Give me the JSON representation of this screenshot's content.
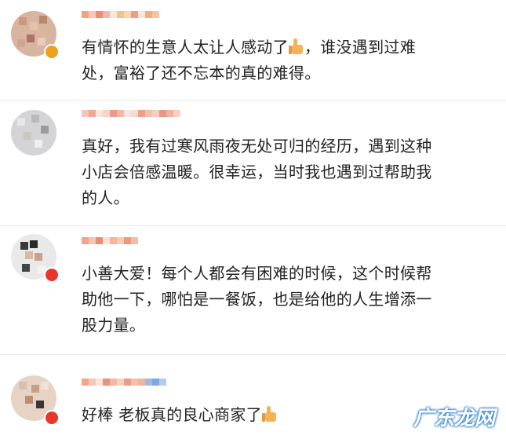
{
  "comments": [
    {
      "text_lines": [
        "有情怀的生意人太让人感动了",
        "，谁没遇到过难",
        "处，富裕了还不忘本的真的难得。"
      ],
      "user_colors": [
        "#f2a27c",
        "#f6c9b3",
        "#ea8f77",
        "#f4b9a0",
        "#f3c18a",
        "#f7d6b0",
        "#e8a07f",
        "#f0b07a",
        "#f7c3a1",
        "#e68e6f",
        "#f1b18b"
      ]
    },
    {
      "text_lines": [
        "真好，我有过寒风雨夜无处可归的经历，遇到这种",
        "小店会倍感温暖。很幸运，当时我也遇到过帮助我",
        "的人。"
      ],
      "user_colors": [
        "#f4c6b7",
        "#f0a79a",
        "#f7d4c8",
        "#ea9b8e",
        "#f3b7a6",
        "#f8dcd2",
        "#ee9f90",
        "#f2c0b2",
        "#f6cdbf",
        "#e9958a",
        "#f3b1a3",
        "#f7d1c5"
      ]
    },
    {
      "text_lines": [
        "小善大爱！每个人都会有困难的时候，这个时候帮",
        "助他一下，哪怕是一餐饭，也是给他的人生增添一",
        "股力量。"
      ],
      "user_colors": [
        "#f1a58c",
        "#f6c4b0",
        "#e88e72",
        "#f3b59c",
        "#f7cdb8",
        "#ed9a80",
        "#f4bda6"
      ]
    },
    {
      "text_lines": [
        "好棒 老板真的良心商家了"
      ],
      "user_colors": [
        "#f2a78c",
        "#f6c7b3",
        "#ea9377",
        "#f3b9a2",
        "#f7d2bf",
        "#ee9d84",
        "#f4bfa9",
        "#f1b49a",
        "#9bbbe6",
        "#7fa7e0",
        "#b3cdf0"
      ]
    }
  ],
  "watermark": "广东龙网"
}
